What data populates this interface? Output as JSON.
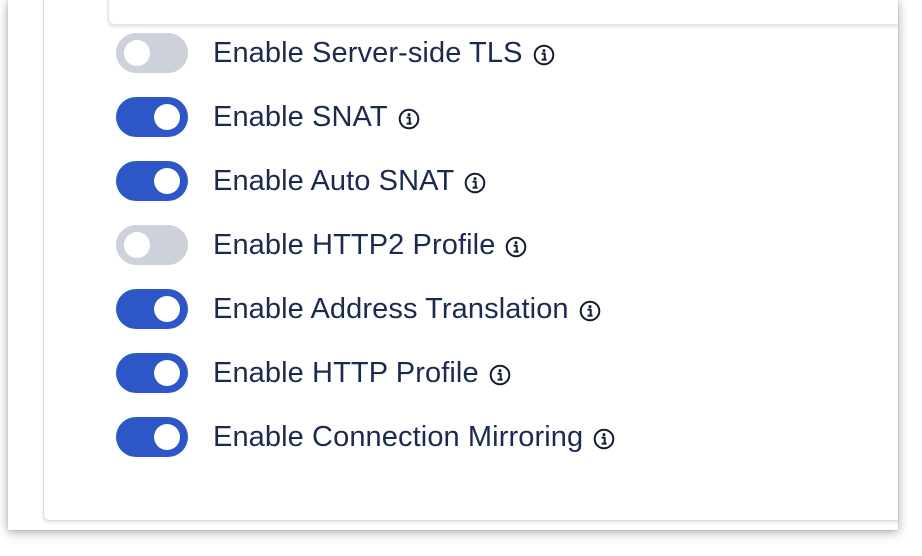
{
  "settings": {
    "toggles": [
      {
        "label": "Enable Server-side TLS",
        "enabled": false,
        "info_icon": "info-icon"
      },
      {
        "label": "Enable SNAT",
        "enabled": true,
        "info_icon": "info-icon"
      },
      {
        "label": "Enable Auto SNAT",
        "enabled": true,
        "info_icon": "info-icon"
      },
      {
        "label": "Enable HTTP2 Profile",
        "enabled": false,
        "info_icon": "info-icon"
      },
      {
        "label": "Enable Address Translation",
        "enabled": true,
        "info_icon": "info-icon"
      },
      {
        "label": "Enable HTTP Profile",
        "enabled": true,
        "info_icon": "info-icon"
      },
      {
        "label": "Enable Connection Mirroring",
        "enabled": true,
        "info_icon": "info-icon"
      }
    ]
  },
  "colors": {
    "toggle_on": "#2d56c6",
    "toggle_off": "#cdd1da",
    "label_text": "#1c2a52"
  }
}
